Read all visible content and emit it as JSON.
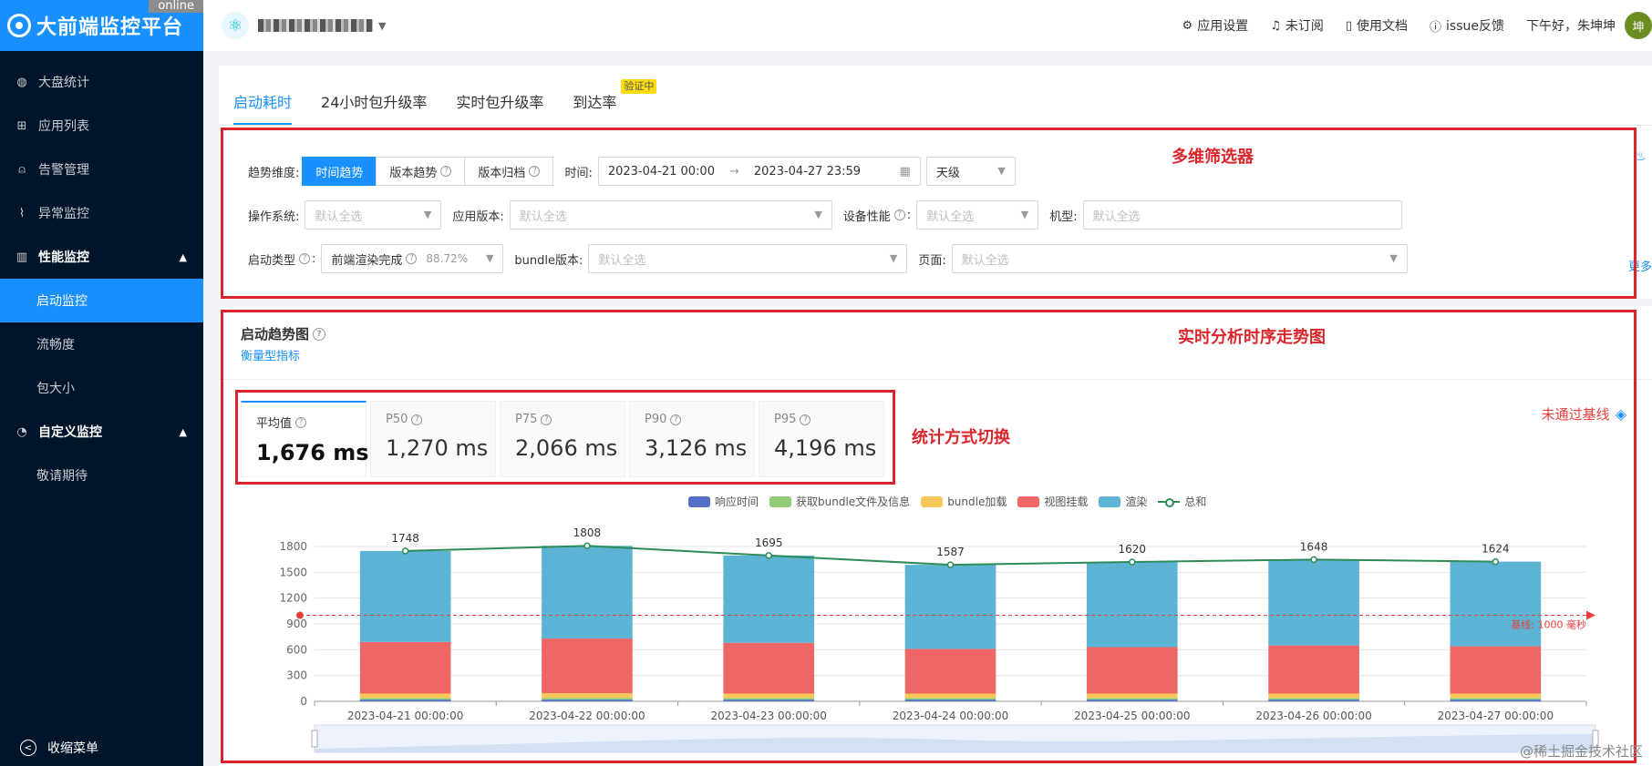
{
  "brand": {
    "title": "大前端监控平台",
    "online_tag": "online"
  },
  "sidebar": {
    "items": [
      {
        "label": "大盘统计",
        "icon": "globe-icon"
      },
      {
        "label": "应用列表",
        "icon": "cluster-icon"
      },
      {
        "label": "告警管理",
        "icon": "alarm-icon"
      },
      {
        "label": "异常监控",
        "icon": "line-chart-icon"
      }
    ],
    "perf_group": {
      "label": "性能监控",
      "children": [
        "启动监控",
        "流畅度",
        "包大小"
      ]
    },
    "custom_group": {
      "label": "自定义监控",
      "children": [
        "敬请期待"
      ]
    },
    "collapse_label": "收缩菜单"
  },
  "header": {
    "links": [
      {
        "label": "应用设置",
        "icon": "setting-icon"
      },
      {
        "label": "未订阅",
        "icon": "bell-icon"
      },
      {
        "label": "使用文档",
        "icon": "file-icon"
      },
      {
        "label": "issue反馈",
        "icon": "info-icon"
      }
    ],
    "greeting": "下午好，朱坤坤",
    "avatar_text": "坤"
  },
  "tabs": [
    {
      "label": "启动耗时"
    },
    {
      "label": "24小时包升级率"
    },
    {
      "label": "实时包升级率"
    },
    {
      "label": "到达率",
      "badge": "验证中"
    }
  ],
  "filters": {
    "trend_label": "趋势维度:",
    "trend_options": [
      "时间趋势",
      "版本趋势",
      "版本归档"
    ],
    "time_label": "时间:",
    "time_start": "2023-04-21 00:00",
    "time_end": "2023-04-27 23:59",
    "granularity": "天级",
    "os_label": "操作系统:",
    "app_version_label": "应用版本:",
    "device_label": "设备性能",
    "model_label": "机型:",
    "start_type_label": "启动类型",
    "start_type_value": "前端渲染完成",
    "start_type_pct": "88.72%",
    "bundle_label": "bundle版本:",
    "page_label": "页面:",
    "placeholder": "默认全选",
    "more": "更多"
  },
  "chart_card": {
    "title": "启动趋势图",
    "subtitle": "衡量型指标",
    "stats": [
      {
        "label": "平均值",
        "value": "1,676 ms"
      },
      {
        "label": "P50",
        "value": "1,270 ms"
      },
      {
        "label": "P75",
        "value": "2,066 ms"
      },
      {
        "label": "P90",
        "value": "3,126 ms"
      },
      {
        "label": "P95",
        "value": "4,196 ms"
      }
    ],
    "baseline_status": "未通过基线"
  },
  "annotations": {
    "filter": "多维筛选器",
    "chart": "实时分析时序走势图",
    "stats": "统计方式切换"
  },
  "watermark": "@稀土掘金技术社区",
  "colors": {
    "primary": "#1890ff",
    "annotation": "#d9252b"
  },
  "chart_data": {
    "type": "bar",
    "stacked": true,
    "categories": [
      "2023-04-21 00:00:00",
      "2023-04-22 00:00:00",
      "2023-04-23 00:00:00",
      "2023-04-24 00:00:00",
      "2023-04-25 00:00:00",
      "2023-04-26 00:00:00",
      "2023-04-27 00:00:00"
    ],
    "series": [
      {
        "name": "响应时间",
        "color": "#5470c6",
        "values": [
          20,
          20,
          20,
          20,
          20,
          20,
          20
        ]
      },
      {
        "name": "获取bundle文件及信息",
        "color": "#91cc75",
        "values": [
          20,
          20,
          20,
          20,
          20,
          20,
          20
        ]
      },
      {
        "name": "bundle加载",
        "color": "#fac858",
        "values": [
          50,
          55,
          50,
          50,
          50,
          50,
          50
        ]
      },
      {
        "name": "视图挂载",
        "color": "#ee6666",
        "values": [
          600,
          635,
          590,
          520,
          540,
          560,
          550
        ]
      },
      {
        "name": "渲染",
        "color": "#5cb3d3",
        "values": [
          1058,
          1078,
          1015,
          977,
          990,
          998,
          984
        ]
      }
    ],
    "line": {
      "name": "总和",
      "color": "#2e8b57",
      "values": [
        1748,
        1808,
        1695,
        1587,
        1620,
        1648,
        1624
      ]
    },
    "baseline": {
      "value": 1000,
      "label": "基线: 1000 毫秒"
    },
    "yticks": [
      0,
      300,
      600,
      900,
      1200,
      1500,
      1800
    ],
    "ylim": [
      0,
      1800
    ]
  }
}
